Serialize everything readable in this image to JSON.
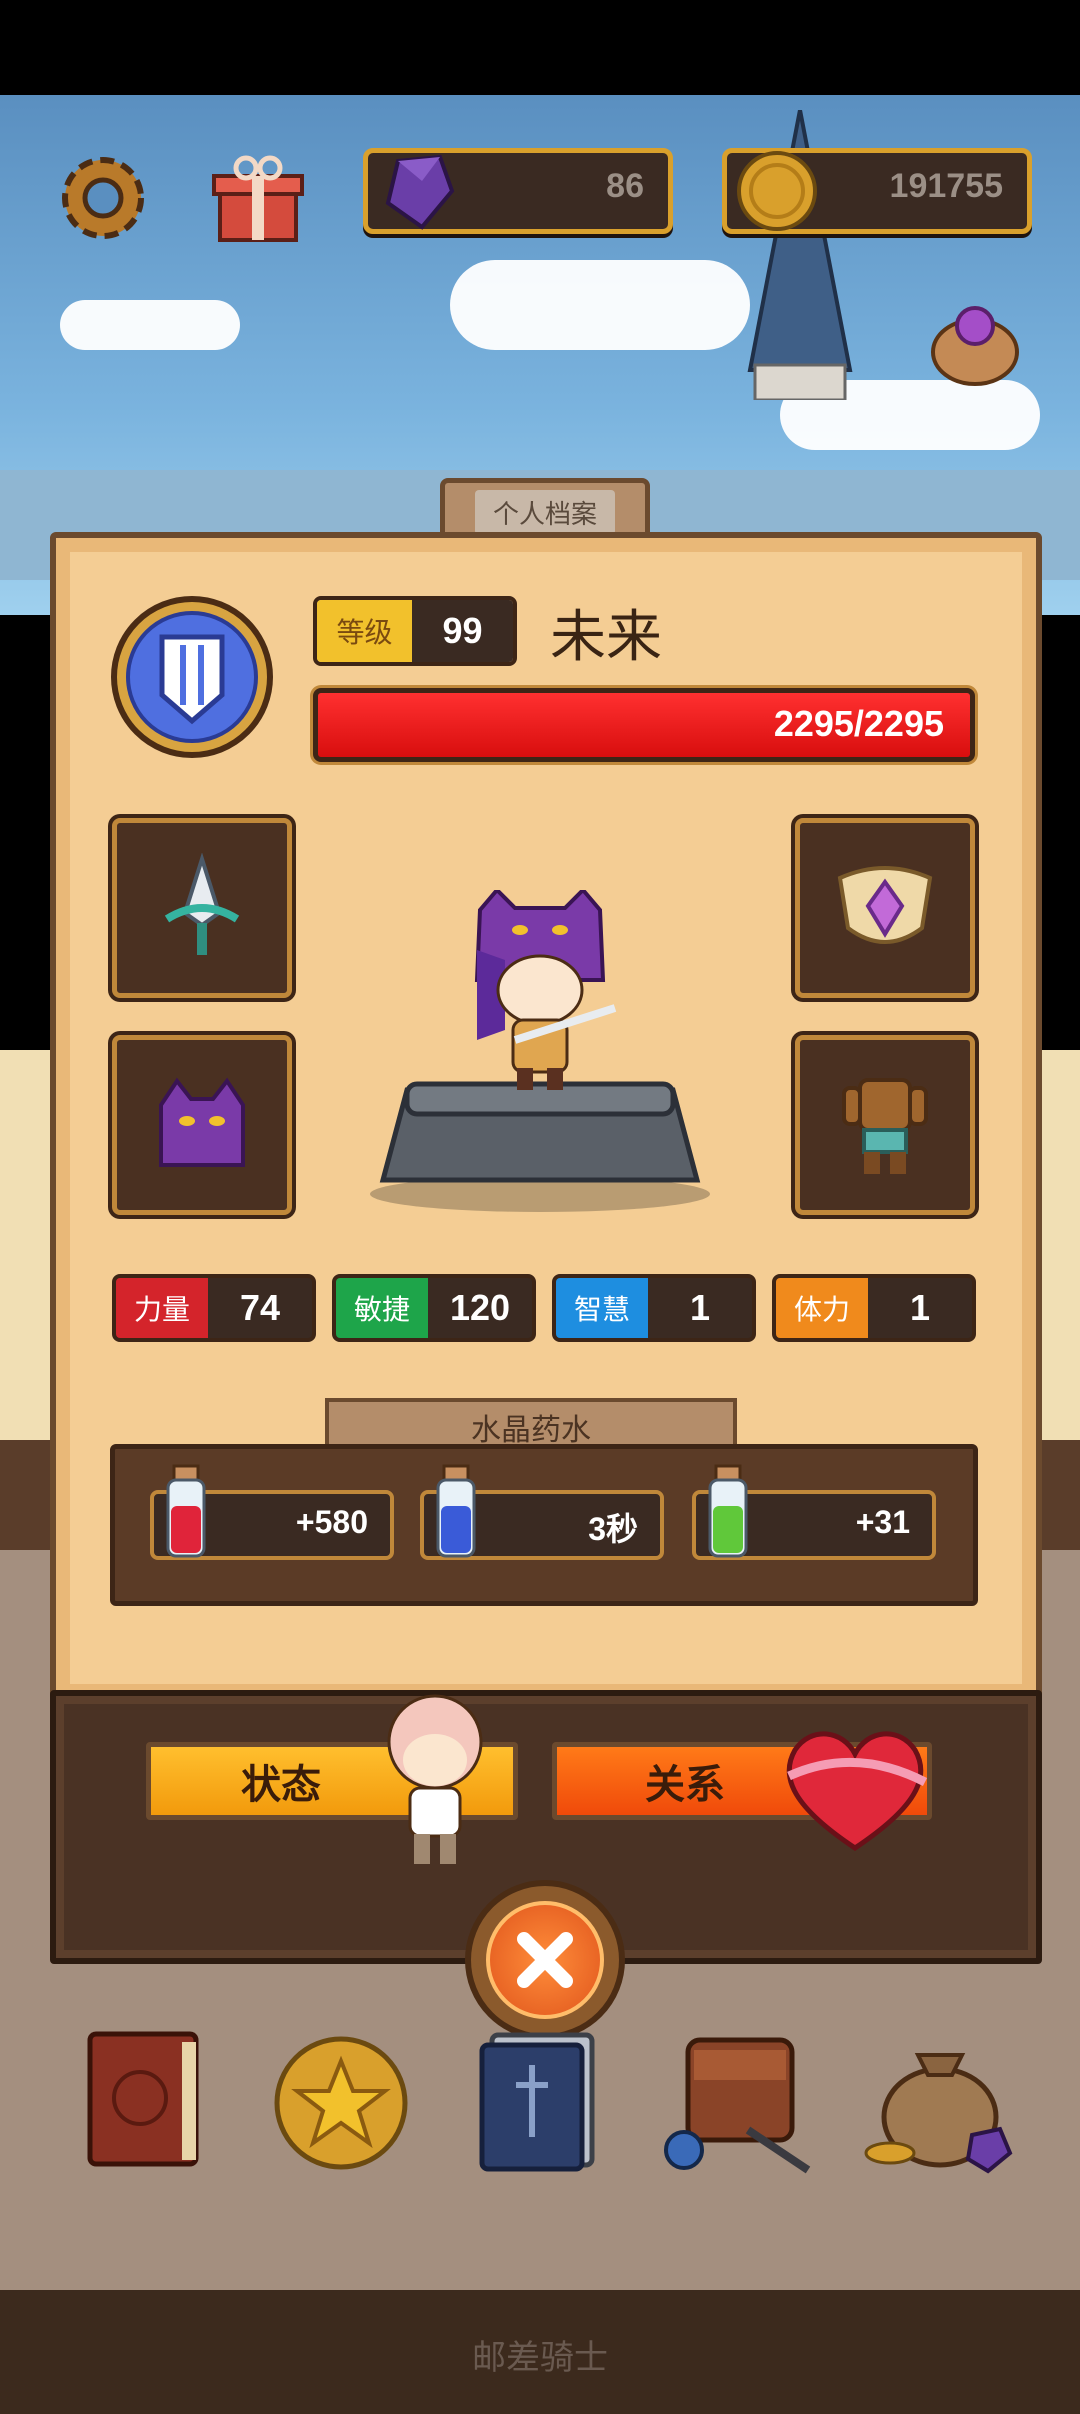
{
  "topbar": {
    "gems": "86",
    "coins": "191755"
  },
  "panel": {
    "tab_label": "个人档案",
    "level_label": "等级",
    "level_value": "99",
    "player_name": "未来",
    "hp_text": "2295/2295",
    "hp_fraction": 1.0
  },
  "stats": [
    {
      "label": "力量",
      "value": "74",
      "color": "#d4242b"
    },
    {
      "label": "敏捷",
      "value": "120",
      "color": "#1ea54a"
    },
    {
      "label": "智慧",
      "value": "1",
      "color": "#1e8ee0"
    },
    {
      "label": "体力",
      "value": "1",
      "color": "#f08a1c"
    }
  ],
  "potions": {
    "title": "水晶药水",
    "items": [
      {
        "value": "+580",
        "liquid": "#e0243a"
      },
      {
        "value": "3秒",
        "liquid": "#3a5bd8"
      },
      {
        "value": "+31",
        "liquid": "#60c83a"
      }
    ]
  },
  "actions": {
    "status_label": "状态",
    "relation_label": "关系"
  },
  "footer": {
    "label": "邮差骑士"
  },
  "colors": {
    "accent_gold": "#d9a02c",
    "panel_bg": "#f4cd94",
    "hp_red": "#e01010"
  }
}
